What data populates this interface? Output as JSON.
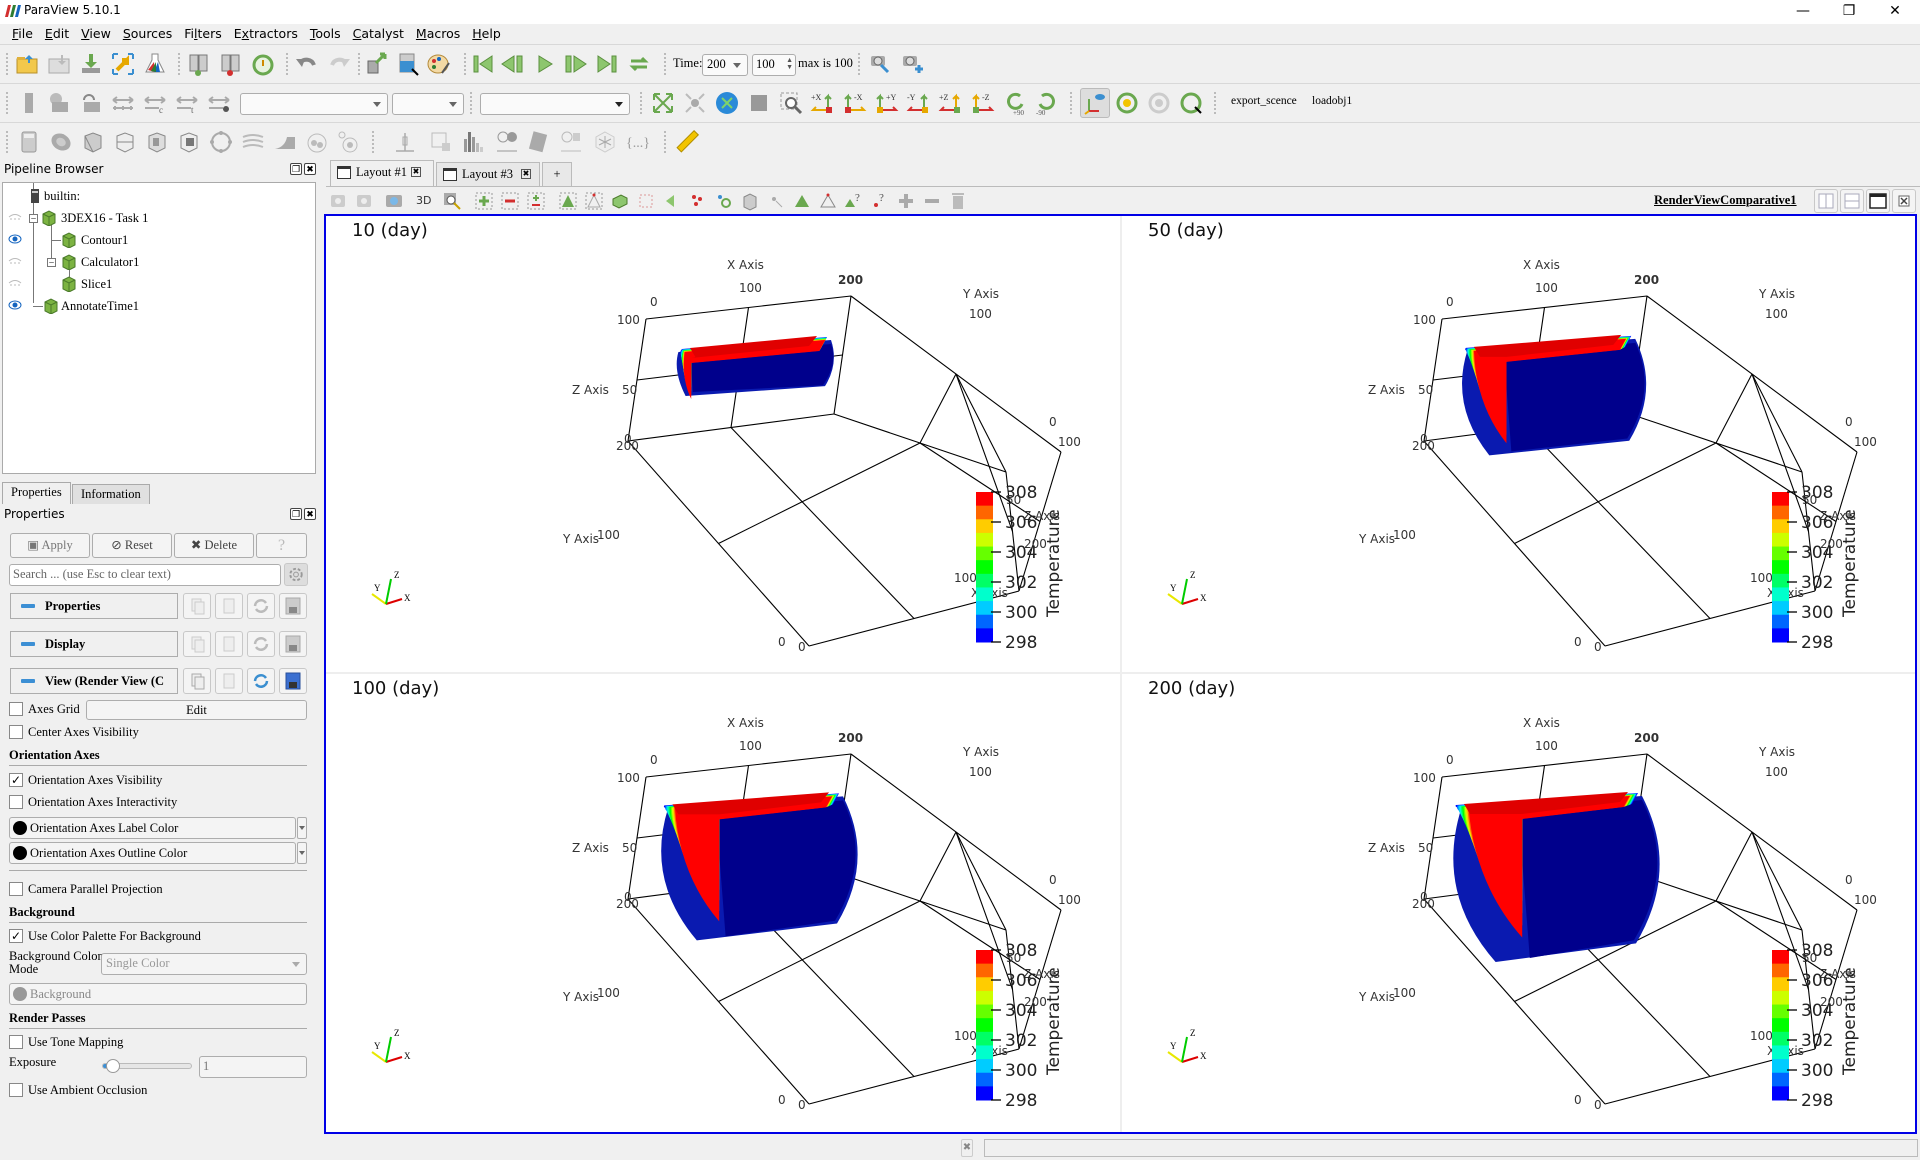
{
  "window": {
    "title": "ParaView 5.10.1",
    "controls": [
      "minimize",
      "restore",
      "close"
    ]
  },
  "menubar": {
    "items": [
      {
        "label": "File",
        "mnemonic": "F",
        "rest": "ile"
      },
      {
        "label": "Edit",
        "mnemonic": "E",
        "rest": "dit"
      },
      {
        "label": "View",
        "mnemonic": "V",
        "rest": "iew"
      },
      {
        "label": "Sources",
        "mnemonic": "S",
        "rest": "ources"
      },
      {
        "label": "Filters",
        "mnemonic": "Fi",
        "rest": "lters"
      },
      {
        "label": "Extractors",
        "mnemonic": "E",
        "rest": "xtractors"
      },
      {
        "label": "Tools",
        "mnemonic": "T",
        "rest": "ools"
      },
      {
        "label": "Catalyst",
        "mnemonic": "C",
        "rest": "atalyst"
      },
      {
        "label": "Macros",
        "mnemonic": "M",
        "rest": "acros"
      },
      {
        "label": "Help",
        "mnemonic": "H",
        "rest": "elp"
      }
    ]
  },
  "toolbar_main": {
    "time_label": "Time:",
    "time_value": "200",
    "timestep_value": "100",
    "max_text": "max is 100"
  },
  "toolbar_camera": {
    "macros": [
      "export_scence",
      "loadobj1"
    ],
    "rotate_plus": "+90",
    "rotate_minus": "-90"
  },
  "pipeline_browser": {
    "title": "Pipeline Browser",
    "items": [
      {
        "label": "builtin:",
        "visible": null,
        "depth": 0
      },
      {
        "label": "3DEX16 - Task 1",
        "visible": false,
        "depth": 1
      },
      {
        "label": "Contour1",
        "visible": true,
        "depth": 2
      },
      {
        "label": "Calculator1",
        "visible": false,
        "depth": 2
      },
      {
        "label": "Slice1",
        "visible": false,
        "depth": 3
      },
      {
        "label": "AnnotateTime1",
        "visible": true,
        "depth": 1
      }
    ]
  },
  "panel_tabs": {
    "properties": "Properties",
    "information": "Information"
  },
  "properties": {
    "title": "Properties",
    "apply": "Apply",
    "reset": "Reset",
    "delete": "Delete",
    "help": "?",
    "search_placeholder": "Search ... (use Esc to clear text)",
    "sections": {
      "properties": "Properties",
      "display": "Display",
      "view": "View (Render View (C"
    },
    "axes_grid": {
      "label": "Axes Grid",
      "checked": false,
      "edit": "Edit"
    },
    "center_axes_visibility": {
      "label": "Center Axes Visibility",
      "checked": false
    },
    "orientation_axes": {
      "title": "Orientation Axes",
      "visibility": {
        "label": "Orientation Axes Visibility",
        "checked": true
      },
      "interactivity": {
        "label": "Orientation Axes Interactivity",
        "checked": false
      },
      "label_color": "Orientation Axes Label Color",
      "outline_color": "Orientation Axes Outline Color"
    },
    "camera_parallel_projection": {
      "label": "Camera Parallel Projection",
      "checked": false
    },
    "background": {
      "title": "Background",
      "use_palette": {
        "label": "Use Color Palette For Background",
        "checked": true
      },
      "mode_label": "Background Color Mode",
      "mode_label_line1": "Background Color",
      "mode_label_line2": "Mode",
      "mode_value": "Single Color",
      "color_label": "Background"
    },
    "render_passes": {
      "title": "Render Passes",
      "tone_mapping": {
        "label": "Use Tone Mapping",
        "checked": false
      },
      "exposure_label": "Exposure",
      "exposure_value": "1",
      "exposure_slider_fraction": 0.05,
      "ambient_occlusion": {
        "label": "Use Ambient Occlusion",
        "checked": false
      }
    }
  },
  "layout_tabs": [
    {
      "label": "Layout #1",
      "active": true
    },
    {
      "label": "Layout #3",
      "active": false
    }
  ],
  "layout_add": "+",
  "view": {
    "name": "RenderViewComparative1",
    "toolbar_3d": "3D"
  },
  "panes": [
    {
      "title": "10 (day)",
      "extent": 0.0
    },
    {
      "title": "50 (day)",
      "extent": 0.55
    },
    {
      "title": "100 (day)",
      "extent": 0.8
    },
    {
      "title": "200 (day)",
      "extent": 1.0
    }
  ],
  "cube_axes": {
    "x_title": "X Axis",
    "y_title": "Y Axis",
    "z_title": "Z Axis",
    "x_ticks": [
      "0",
      "100",
      "200"
    ],
    "y_ticks": [
      "0",
      "100",
      "200"
    ],
    "z_ticks": [
      "0",
      "50",
      "100"
    ]
  },
  "orientation_widget": {
    "x": "X",
    "y": "Y",
    "z": "Z"
  },
  "colorbar": {
    "title": "Temperature",
    "min": 298,
    "max": 308,
    "tick_labels": [
      "308",
      "306",
      "304",
      "302",
      "300",
      "298"
    ],
    "colors": [
      "#ff0000",
      "#ff6600",
      "#ffcc00",
      "#ccff00",
      "#66ff00",
      "#00ff00",
      "#00ff66",
      "#00ffcc",
      "#00ccff",
      "#0066ff",
      "#0000ff"
    ]
  },
  "colors": {
    "view_border": "#0000e6",
    "accent": "#3c8fd4"
  }
}
